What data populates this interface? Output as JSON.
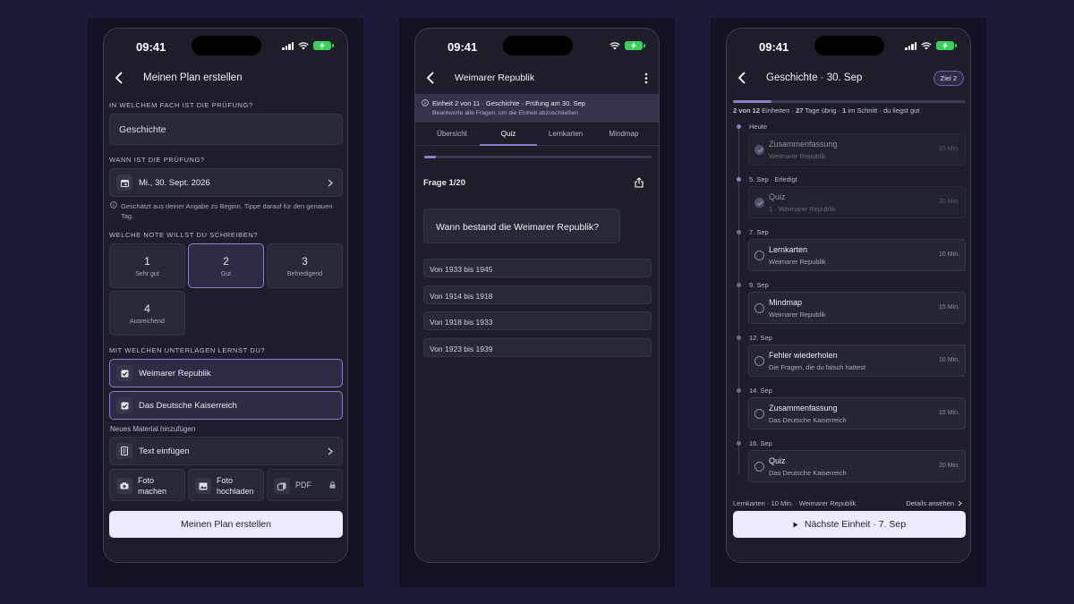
{
  "status": {
    "time": "09:41"
  },
  "s1": {
    "title": "Meinen Plan erstellen",
    "q_subject": "IN WELCHEM FACH IST DIE PRÜFUNG?",
    "subject": "Geschichte",
    "q_date": "WANN IST DIE PRÜFUNG?",
    "date": "Mi., 30. Sept. 2026",
    "date_hint": "Geschätzt aus deiner Angabe zu Beginn. Tippe darauf für den genauen Tag.",
    "q_grade": "WELCHE NOTE WILLST DU SCHREIBEN?",
    "grades": [
      {
        "num": "1",
        "label": "Sehr gut"
      },
      {
        "num": "2",
        "label": "Gut"
      },
      {
        "num": "3",
        "label": "Befriedigend"
      },
      {
        "num": "4",
        "label": "Ausreichend"
      }
    ],
    "selected_grade": "2",
    "q_material": "MIT WELCHEN UNTERLAGEN LERNST DU?",
    "materials": [
      "Weimarer Republik",
      "Das Deutsche Kaiserreich"
    ],
    "add_label": "Neues Material hinzufügen",
    "text_insert": "Text einfügen",
    "photo_take": "Foto machen",
    "photo_upload": "Foto hochladen",
    "pdf": "PDF",
    "cta": "Meinen Plan erstellen"
  },
  "s2": {
    "title": "Weimarer Republik",
    "banner_title": "Einheit 2 von 11 · Geschichte · Prüfung am 30. Sep",
    "banner_sub": "Beantworte alle Fragen, um die Einheit abzuschließen",
    "tabs": [
      "Übersicht",
      "Quiz",
      "Lernkarten",
      "Mindmap"
    ],
    "active_tab": "Quiz",
    "progress": 0.05,
    "question_count": "Frage 1/20",
    "question": "Wann bestand die Weimarer Republik?",
    "answers": [
      "Von 1933 bis 1945",
      "Von 1914 bis 1918",
      "Von 1918 bis 1933",
      "Von 1923 bis 1939"
    ]
  },
  "s3": {
    "title": "Geschichte · 30. Sep",
    "badge": "Ziel 2",
    "progress": 0.167,
    "stats": {
      "done": "2 von 12",
      "done_label": "Einheiten",
      "days": "27",
      "days_label": "Tage übrig",
      "avg": "1",
      "avg_label": "im Schnitt",
      "track": "du liegst gut"
    },
    "entries": [
      {
        "date": "Heute",
        "title": "Zusammenfassung",
        "sub": "Weimarer Republik",
        "dur": "15 Min.",
        "done": true
      },
      {
        "date": "5. Sep · Erledigt",
        "title": "Quiz",
        "sub": "1 · Weimarer Republik",
        "dur": "20 Min.",
        "done": true
      },
      {
        "date": "7. Sep",
        "title": "Lernkarten",
        "sub": "Weimarer Republik",
        "dur": "10 Min.",
        "done": false
      },
      {
        "date": "9. Sep",
        "title": "Mindmap",
        "sub": "Weimarer Republik",
        "dur": "15 Min.",
        "done": false
      },
      {
        "date": "12. Sep",
        "title": "Fehler wiederholen",
        "sub": "Die Fragen, die du falsch hattest",
        "dur": "10 Min.",
        "done": false
      },
      {
        "date": "14. Sep",
        "title": "Zusammenfassung",
        "sub": "Das Deutsche Kaiserreich",
        "dur": "15 Min.",
        "done": false
      },
      {
        "date": "16. Sep",
        "title": "Quiz",
        "sub": "Das Deutsche Kaiserreich",
        "dur": "20 Min.",
        "done": false
      }
    ],
    "footer_info": "Lernkarten · 10 Min. · Weimarer Republik",
    "details": "Details ansehen",
    "next": "Nächste Einheit · 7. Sep"
  }
}
